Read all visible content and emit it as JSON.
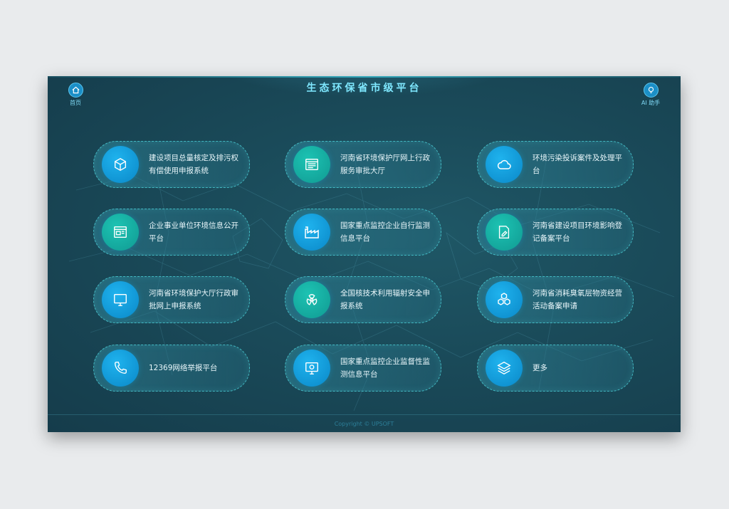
{
  "header": {
    "title": "生态环保省市级平台",
    "home_label": "首页",
    "ai_label": "AI 助手"
  },
  "cards": [
    {
      "label": "建设项目总量核定及排污权有偿使用申报系统",
      "icon": "cube-icon",
      "color": "blue"
    },
    {
      "label": "河南省环境保护厅网上行政服务审批大厅",
      "icon": "window-icon",
      "color": "teal"
    },
    {
      "label": "环境污染投诉案件及处理平台",
      "icon": "cloud-icon",
      "color": "blue"
    },
    {
      "label": "企业事业单位环境信息公开平台",
      "icon": "browser-icon",
      "color": "teal"
    },
    {
      "label": "国家重点监控企业自行监测信息平台",
      "icon": "factory-icon",
      "color": "blue"
    },
    {
      "label": "河南省建设项目环境影响登记备案平台",
      "icon": "document-edit-icon",
      "color": "teal"
    },
    {
      "label": "河南省环境保护大厅行政审批网上申报系统",
      "icon": "monitor-icon",
      "color": "blue"
    },
    {
      "label": "全国核技术利用辐射安全申报系统",
      "icon": "radiation-icon",
      "color": "teal"
    },
    {
      "label": "河南省消耗臭氧层物资经营活动备案申请",
      "icon": "molecule-icon",
      "color": "blue"
    },
    {
      "label": "12369网络举报平台",
      "icon": "phone-icon",
      "color": "blue"
    },
    {
      "label": "国家重点监控企业监督性监测信息平台",
      "icon": "display-camera-icon",
      "color": "blue"
    },
    {
      "label": "更多",
      "icon": "layers-icon",
      "color": "blue"
    }
  ],
  "footer": {
    "copyright": "Copyright © UPSOFT"
  },
  "colors": {
    "background": "#1a4a59",
    "title": "#7fe8ff",
    "icon_blue": "#0a88c8",
    "icon_teal": "#109a92",
    "card_border": "#4ed6dc"
  }
}
